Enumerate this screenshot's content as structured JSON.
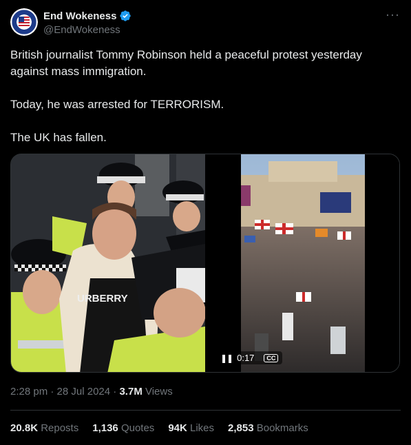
{
  "author": {
    "display_name": "End Wokeness",
    "handle": "@EndWokeness",
    "avatar_icon": "flag-badge-avatar",
    "verified": true,
    "verified_color": "#1d9bf0"
  },
  "post": {
    "paragraphs": [
      "British journalist Tommy Robinson held a peaceful protest yesterday against mass immigration.",
      "Today, he was arrested for TERRORISM.",
      "The UK has fallen."
    ]
  },
  "media": {
    "photo_shirt_text": "URBERRY",
    "video": {
      "timecode": "0:17",
      "cc_label": "CC",
      "pause_icon": "pause-icon"
    }
  },
  "meta": {
    "time": "2:28 pm",
    "sep1": " · ",
    "date": "28 Jul 2024",
    "sep2": " · ",
    "views_count": "3.7M",
    "views_label": " Views"
  },
  "stats": {
    "reposts": {
      "num": "20.8K",
      "label": " Reposts"
    },
    "quotes": {
      "num": "1,136",
      "label": " Quotes"
    },
    "likes": {
      "num": "94K",
      "label": " Likes"
    },
    "bookmarks": {
      "num": "2,853",
      "label": " Bookmarks"
    }
  },
  "colors": {
    "background": "#000000",
    "text": "#e7e9ea",
    "secondary": "#71767b",
    "border": "#2f3336",
    "accent": "#1d9bf0"
  }
}
